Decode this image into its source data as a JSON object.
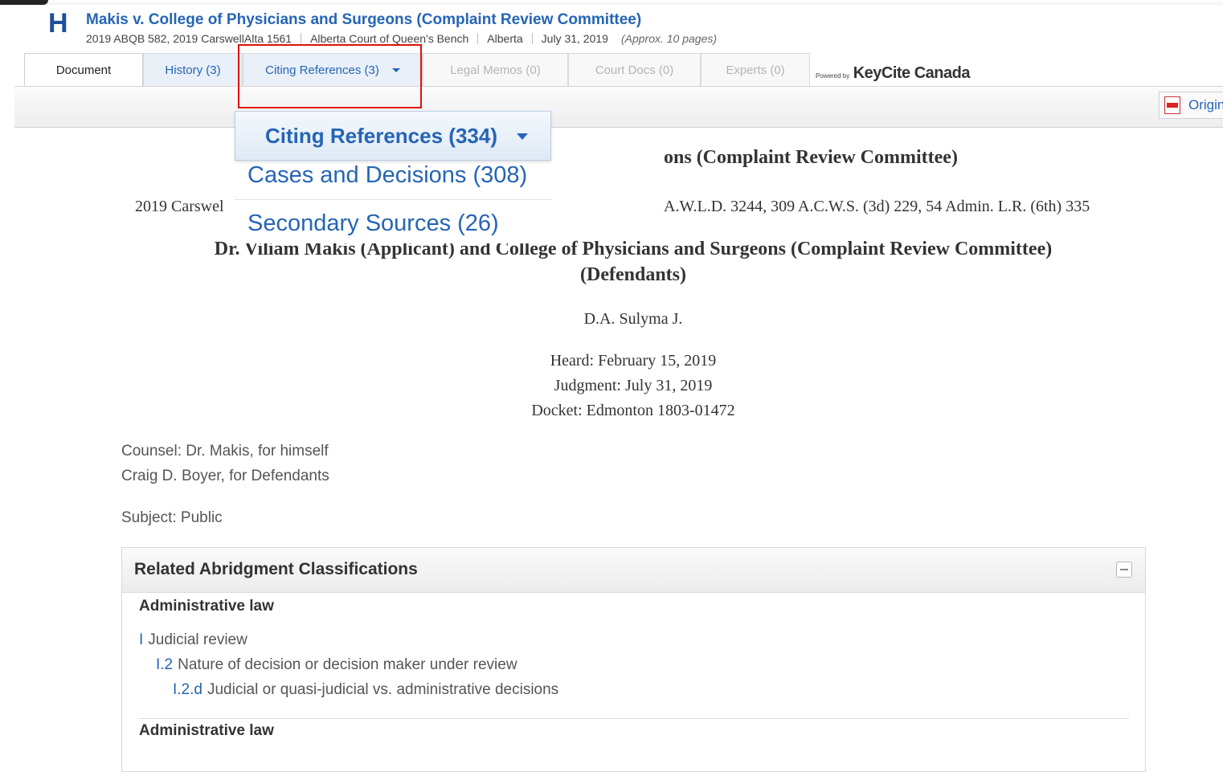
{
  "header": {
    "logo_letter": "H",
    "case_title": "Makis v. College of Physicians and Surgeons (Complaint Review Committee)",
    "citation": "2019 ABQB 582, 2019 CarswellAlta 1561",
    "court": "Alberta Court of Queen's Bench",
    "jurisdiction": "Alberta",
    "date": "July 31, 2019",
    "pages": "(Approx. 10 pages)"
  },
  "tabs": [
    {
      "label": "Document"
    },
    {
      "label": "History (3)"
    },
    {
      "label": "Citing References (3)"
    },
    {
      "label": "Legal Memos (0)"
    },
    {
      "label": "Court Docs (0)"
    },
    {
      "label": "Experts (0)"
    }
  ],
  "keycite": {
    "powered_by": "Powered by",
    "brand": "KeyCite Canada"
  },
  "toolbar": {
    "original_label": "Origin"
  },
  "dropdown": {
    "header": "Citing References (334)",
    "items": [
      {
        "label": "Cases and Decisions (308)"
      },
      {
        "label": "Secondary Sources (26)"
      }
    ]
  },
  "document": {
    "title_fragment": "ons (Complaint Review Committee)",
    "cite_left": "2019 Carswel",
    "cite_right": "A.W.L.D. 3244, 309 A.C.W.S. (3d) 229, 54 Admin. L.R. (6th) 335",
    "parties": "Dr. Viliam Makis (Applicant) and College of Physicians and Surgeons (Complaint Review Committee) (Defendants)",
    "judge": "D.A. Sulyma J.",
    "heard": "Heard: February 15, 2019",
    "judgment": "Judgment: July 31, 2019",
    "docket": "Docket: Edmonton 1803-01472",
    "counsel1": "Counsel: Dr. Makis, for himself",
    "counsel2": "Craig D. Boyer, for Defendants",
    "subject": "Subject: Public"
  },
  "related": {
    "title": "Related Abridgment Classifications",
    "sections": [
      {
        "title": "Administrative law",
        "lines": [
          {
            "code": "I",
            "text": "Judicial review"
          },
          {
            "code": "I.2",
            "text": "Nature of decision or decision maker under review"
          },
          {
            "code": "I.2.d",
            "text": "Judicial or quasi-judicial vs. administrative decisions"
          }
        ]
      },
      {
        "title": "Administrative law",
        "lines": []
      }
    ]
  }
}
